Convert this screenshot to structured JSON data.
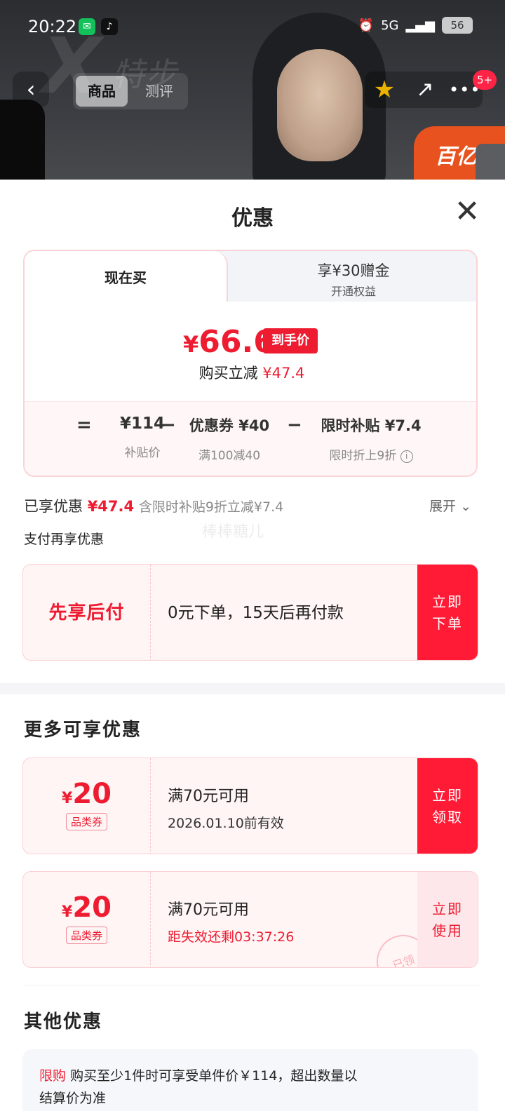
{
  "status": {
    "time": "20:22",
    "battery": "56",
    "network": "5G"
  },
  "nav": {
    "tab_product": "商品",
    "tab_review": "测评",
    "badge": "5+"
  },
  "hero": {
    "logo_text": "X",
    "brand_text": "特步",
    "sign_text": "百亿"
  },
  "sheet": {
    "title": "优惠",
    "tab_buy_now": "现在买",
    "tab_gift": "享¥30赠金",
    "tab_gift_sub": "开通权益",
    "price_currency": "¥",
    "price_value": "66.6",
    "hand_price_tag": "到手价",
    "save_prefix": "购买立减",
    "save_amount": "¥47.4",
    "calc": {
      "eq": "=",
      "minus": "−",
      "subsidy_price": "¥114",
      "subsidy_price_label": "补贴价",
      "coupon": "优惠券 ¥40",
      "coupon_label": "满100减40",
      "limited": "限时补贴 ¥7.4",
      "limited_label": "限时折上9折",
      "info_icon": "i"
    },
    "enjoyed_prefix": "已享优惠",
    "enjoyed_amount": "¥47.4",
    "enjoyed_note": "含限时补贴9折立减¥7.4",
    "expand": "展开",
    "watermark": "棒棒糖儿",
    "pay_title": "支付再享优惠",
    "bnpl": {
      "label": "先享后付",
      "text": "0元下单，15天后再付款",
      "btn_line1": "立即",
      "btn_line2": "下单"
    },
    "more_title": "更多可享优惠",
    "coupons": [
      {
        "currency": "¥",
        "amount": "20",
        "tag": "品类券",
        "title": "满70元可用",
        "sub": "2026.01.10前有效",
        "btn_line1": "立即",
        "btn_line2": "领取"
      },
      {
        "currency": "¥",
        "amount": "20",
        "tag": "品类券",
        "title": "满70元可用",
        "sub": "距失效还剩03:37:26",
        "btn_line1": "立即",
        "btn_line2": "使用",
        "stamp": "已领"
      }
    ],
    "other_title": "其他优惠",
    "other": {
      "limit_label": "限购",
      "limit_text": "购买至少1件时可享受单件价￥114，超出数量以",
      "limit_text2": "结算价为准"
    }
  }
}
